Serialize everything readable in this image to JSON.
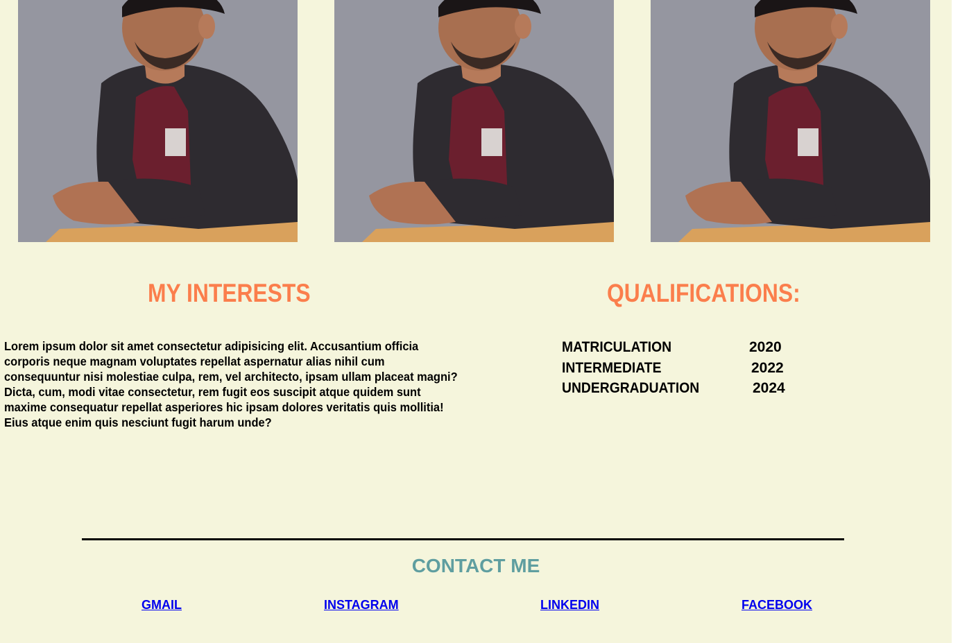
{
  "gallery": {
    "photos": [
      {
        "alt": "profile photo"
      },
      {
        "alt": "profile photo"
      },
      {
        "alt": "profile photo"
      }
    ]
  },
  "interests": {
    "heading": "MY INTERESTS",
    "text": "Lorem ipsum dolor sit amet consectetur adipisicing elit. Accusantium officia corporis neque magnam voluptates repellat aspernatur alias nihil cum consequuntur nisi molestiae culpa, rem, vel architecto, ipsam ullam placeat magni? Dicta, cum, modi vitae consectetur, rem fugit eos suscipit atque quidem sunt maxime consequatur repellat asperiores hic ipsam dolores veritatis quis mollitia! Eius atque enim quis nesciunt fugit harum unde?"
  },
  "qualifications": {
    "heading": "QUALIFICATIONS:",
    "items": [
      {
        "name": "MATRICULATION",
        "year": "2020"
      },
      {
        "name": "INTERMEDIATE",
        "year": "2022"
      },
      {
        "name": "UNDERGRADUATION",
        "year": "2024"
      }
    ]
  },
  "contact": {
    "heading": "CONTACT ME",
    "links": [
      {
        "label": "GMAIL"
      },
      {
        "label": "INSTAGRAM"
      },
      {
        "label": "LINKEDIN"
      },
      {
        "label": "FACEBOOK"
      }
    ]
  },
  "colors": {
    "page_background": "#f5f5dc",
    "heading_accent": "#fb7e4c",
    "contact_heading": "#5f9ea0",
    "link": "#0000ee",
    "photo_backdrop": "#9596a0"
  }
}
